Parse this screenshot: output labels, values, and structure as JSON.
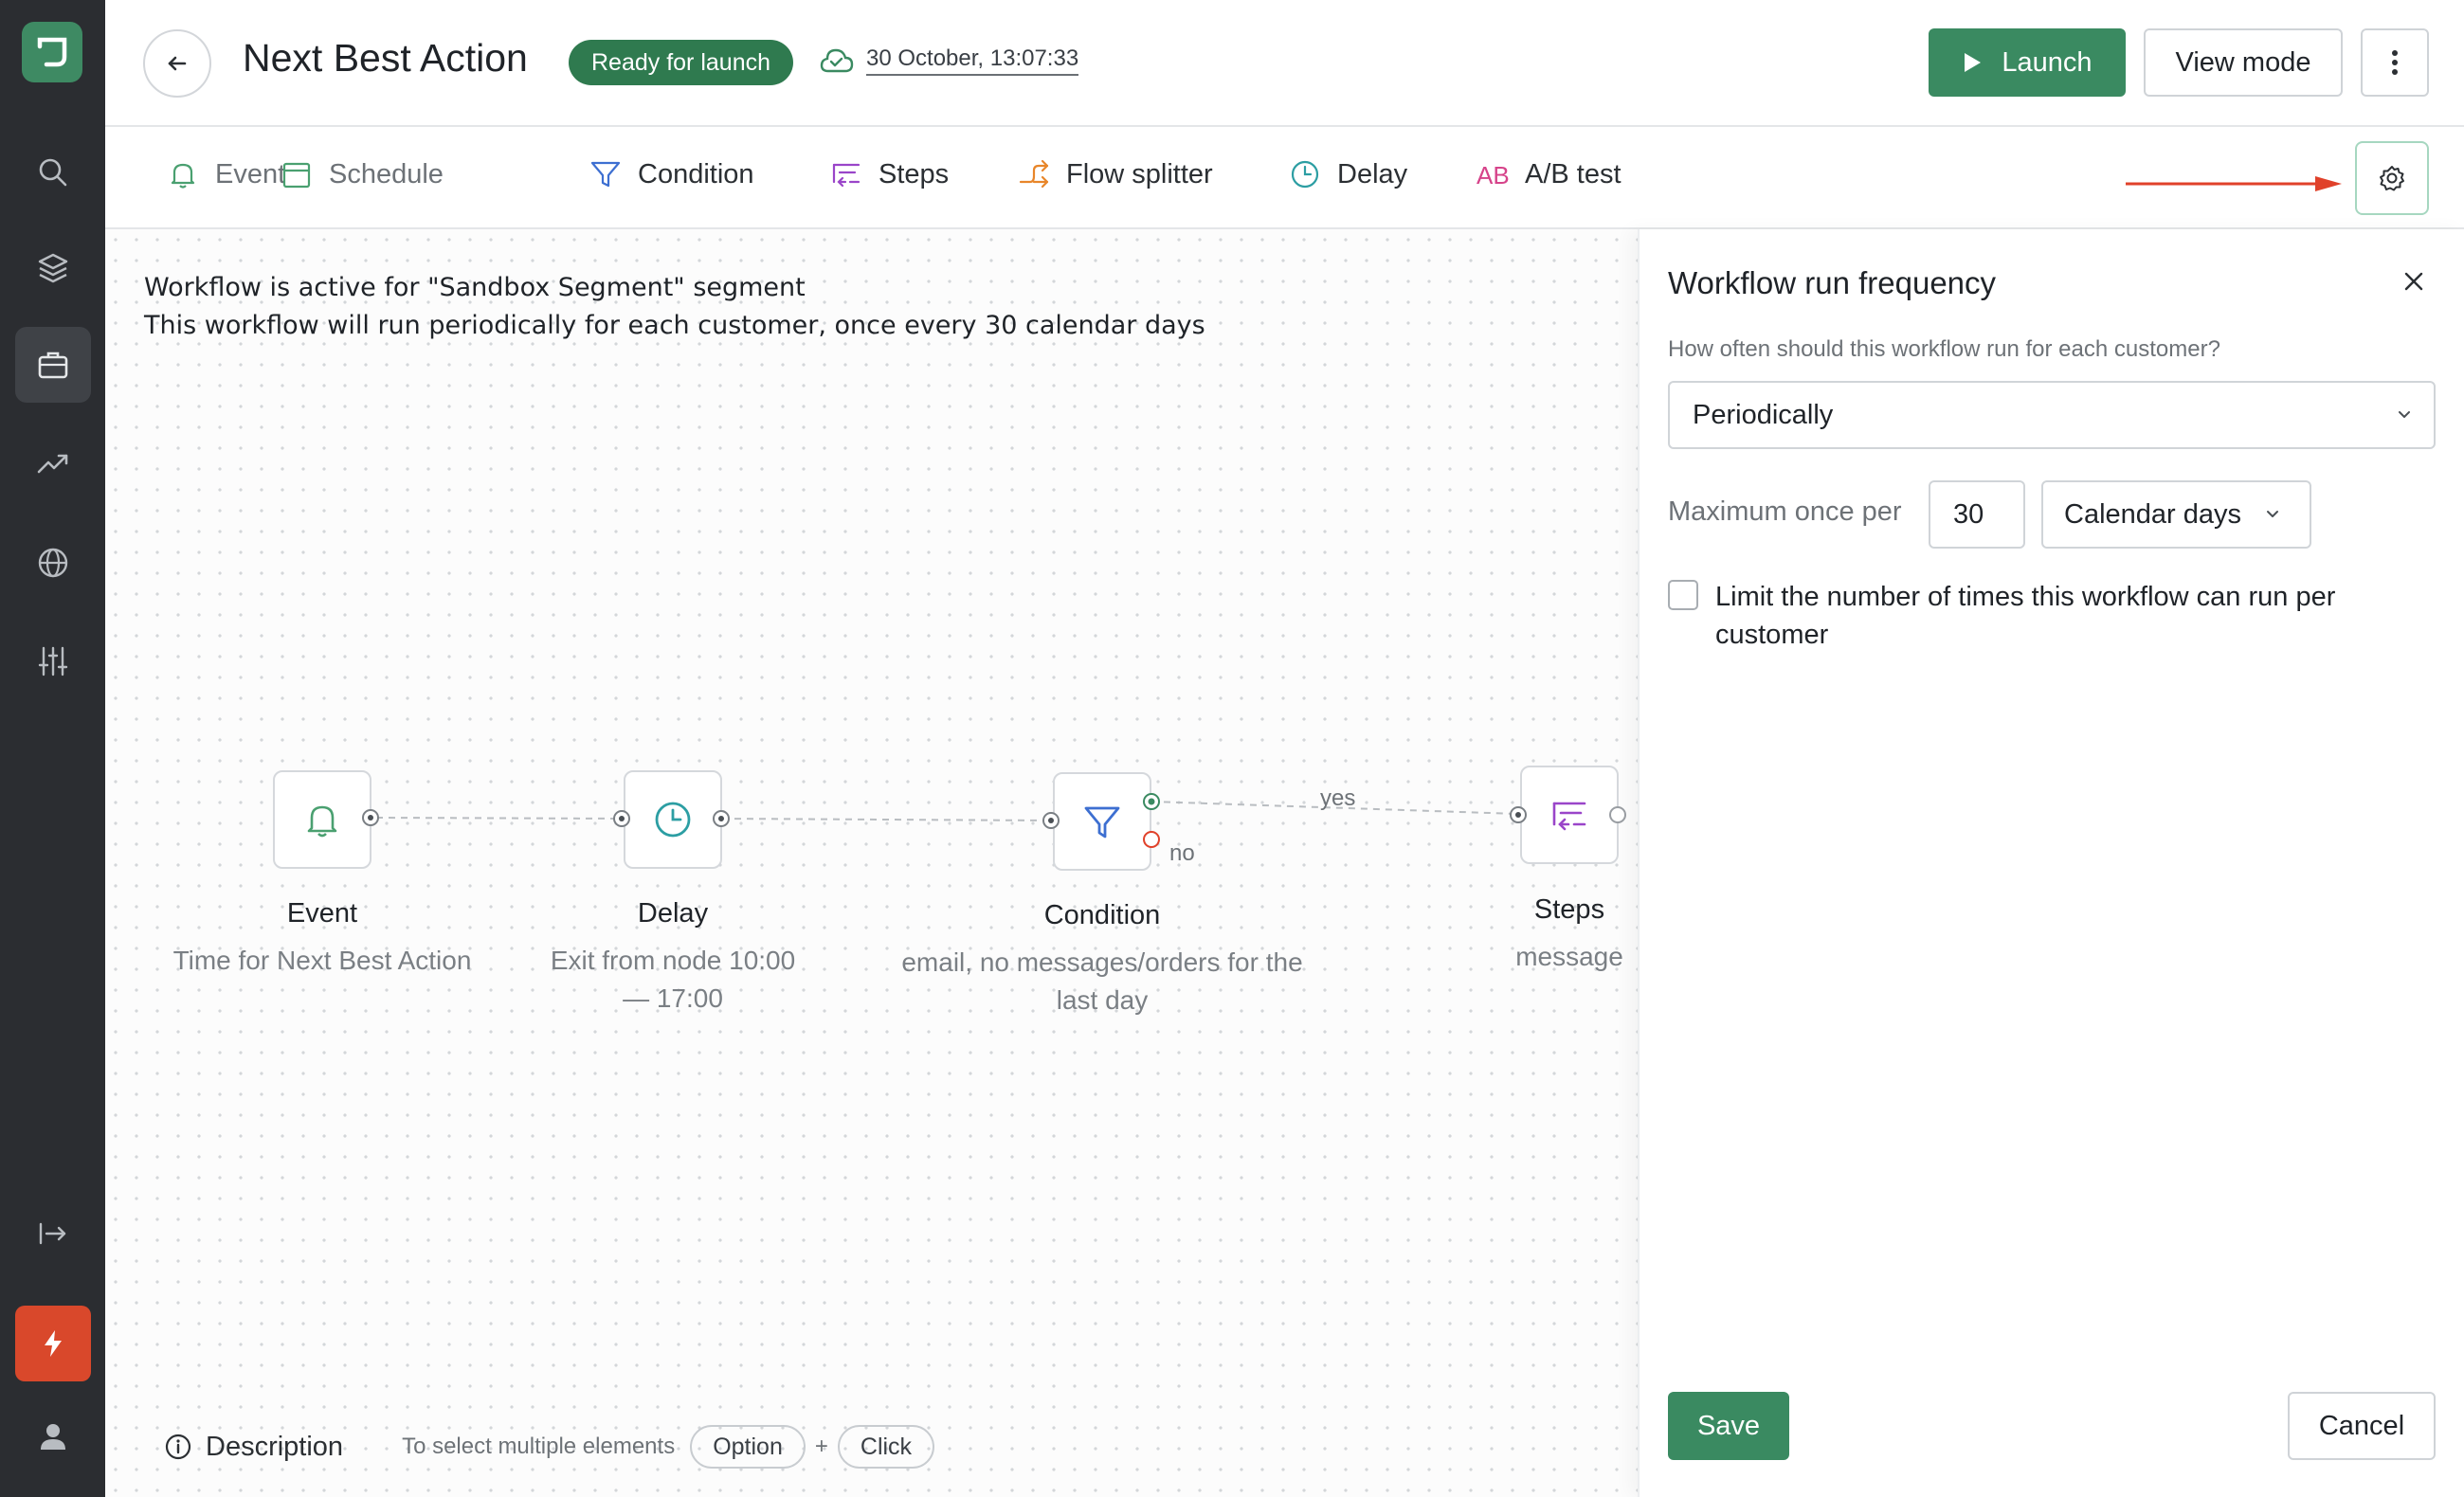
{
  "header": {
    "title": "Next Best Action",
    "status": "Ready for launch",
    "saved_at": "30 October, 13:07:33",
    "launch_label": "Launch",
    "view_mode_label": "View mode"
  },
  "toolbar": {
    "items": [
      {
        "label": "Event",
        "icon": "bell-icon"
      },
      {
        "label": "Schedule",
        "icon": "calendar-icon"
      },
      {
        "label": "Condition",
        "icon": "filter-icon"
      },
      {
        "label": "Steps",
        "icon": "steps-icon"
      },
      {
        "label": "Flow splitter",
        "icon": "split-arrows-icon"
      },
      {
        "label": "Delay",
        "icon": "clock-icon"
      },
      {
        "label": "A/B test",
        "icon": "ab-icon"
      }
    ]
  },
  "canvas": {
    "info_line1": "Workflow is active for \"Sandbox Segment\" segment",
    "info_line2": "This workflow will run periodically for each customer, once every 30 calendar days",
    "nodes": [
      {
        "title": "Event",
        "subtitle": "Time for Next Best Action",
        "icon": "bell-icon"
      },
      {
        "title": "Delay",
        "subtitle": "Exit from node 10:00 — 17:00",
        "icon": "clock-icon"
      },
      {
        "title": "Condition",
        "subtitle": "email, no messages/orders for the last day",
        "icon": "filter-icon"
      },
      {
        "title": "Steps",
        "subtitle": "message",
        "icon": "steps-icon"
      }
    ],
    "edge_yes": "yes",
    "edge_no": "no",
    "description_label": "Description",
    "multi_select_hint": "To select multiple elements",
    "key_option": "Option",
    "key_plus": "+",
    "key_click": "Click"
  },
  "panel": {
    "title": "Workflow run frequency",
    "question": "How often should this workflow run for each customer?",
    "frequency_value": "Periodically",
    "max_label": "Maximum once per",
    "max_value": "30",
    "unit_value": "Calendar days",
    "limit_label": "Limit the number of times this workflow can run per customer",
    "limit_checked": false,
    "save_label": "Save",
    "cancel_label": "Cancel"
  },
  "colors": {
    "brand_green": "#3a8a61",
    "badge_green": "#2f7a4f",
    "sidebar_bg": "#2b2d31",
    "alert_orange": "#d9482b",
    "arrow_red": "#e0412a"
  }
}
